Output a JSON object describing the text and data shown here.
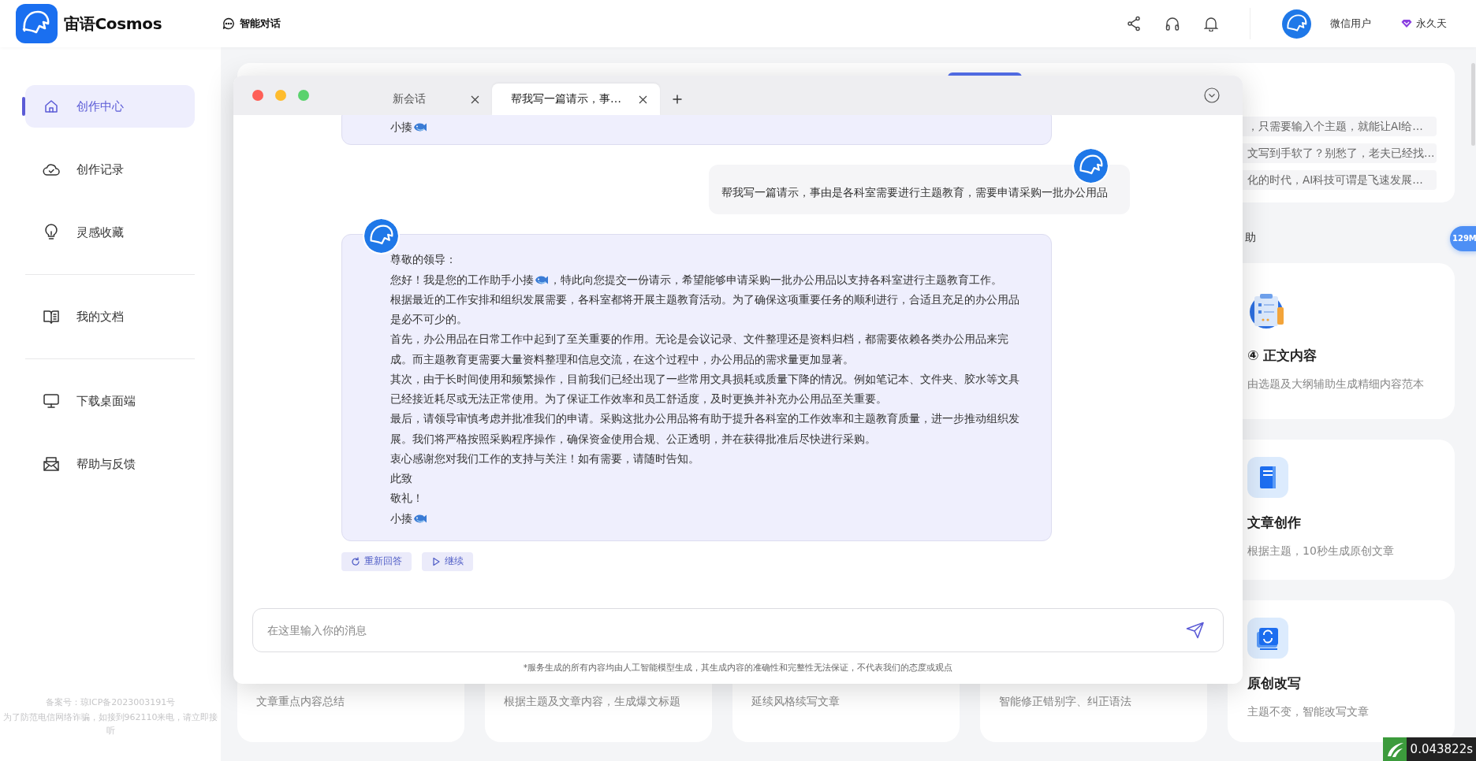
{
  "header": {
    "brand": "宙语Cosmos",
    "nav_label": "智能对话",
    "user_name": "微信用户",
    "membership": "永久天"
  },
  "sidebar": {
    "sections": [
      {
        "items": [
          {
            "label": "创作中心",
            "selected": true
          },
          {
            "label": "创作记录",
            "selected": false
          },
          {
            "label": "灵感收藏",
            "selected": false
          }
        ]
      },
      {
        "items": [
          {
            "label": "我的文档",
            "selected": false
          }
        ]
      },
      {
        "items": [
          {
            "label": "下载桌面端",
            "selected": false
          },
          {
            "label": "帮助与反馈",
            "selected": false
          }
        ]
      }
    ],
    "footer": [
      "备案号：琼ICP备2023003191号",
      "为了防范电信网络诈骗，如接到962110来电，请立即接听"
    ]
  },
  "background": {
    "suggestions": [
      "，只需要输入个主题，就能让AI给…",
      "文写到手软了？别愁了，老夫已经找…",
      "化的时代，AI科技可谓是飞速发展…"
    ],
    "section_heading": "助",
    "memory_badge": "129M",
    "feature_cards": [
      {
        "title": "④ 正文内容",
        "description": "由选题及大纲辅助生成精细内容范本"
      },
      {
        "title": "文章创作",
        "description": "根据主题，10秒生成原创文章"
      },
      {
        "title": "原创改写",
        "description": "主题不变，智能改写文章"
      }
    ],
    "bottom_cards": [
      {
        "description": "文章重点内容总结"
      },
      {
        "description": "根据主题及文章内容，生成爆文标题"
      },
      {
        "description": "延续风格续写文章"
      },
      {
        "description": "智能修正错别字、纠正语法"
      }
    ]
  },
  "chat_window": {
    "tabs": [
      {
        "label": "新会话",
        "selected": false
      },
      {
        "label": "帮我写一篇请示，事…",
        "selected": true
      }
    ],
    "messages": [
      {
        "kind": "assistant",
        "clipped": true,
        "paragraphs": [
          {
            "parts": [
              "小揍"
            ],
            "fish": true
          }
        ]
      },
      {
        "kind": "user",
        "clipped": false,
        "paragraphs": [
          {
            "parts": [
              "帮我写一篇请示，事由是各科室需要进行主题教育，需要申请采购一批办公用品"
            ],
            "fish": false
          }
        ]
      },
      {
        "kind": "assistant",
        "clipped": false,
        "paragraphs": [
          {
            "parts": [
              "尊敬的领导："
            ],
            "fish": false
          },
          {
            "parts": [
              "您好！我是您的工作助手小揍",
              "，特此向您提交一份请示，希望能够申请采购一批办公用品以支持各科室进行主题教育工作。"
            ],
            "fish": false
          },
          {
            "parts": [
              "根据最近的工作安排和组织发展需要，各科室都将开展主题教育活动。为了确保这项重要任务的顺利进行，合适且充足的办公用品是必不可少的。"
            ],
            "fish": false
          },
          {
            "parts": [
              "首先，办公用品在日常工作中起到了至关重要的作用。无论是会议记录、文件整理还是资料归档，都需要依赖各类办公用品来完成。而主题教育更需要大量资料整理和信息交流，在这个过程中，办公用品的需求量更加显著。"
            ],
            "fish": false
          },
          {
            "parts": [
              "其次，由于长时间使用和频繁操作，目前我们已经出现了一些常用文具损耗或质量下降的情况。例如笔记本、文件夹、胶水等文具已经接近耗尽或无法正常使用。为了保证工作效率和员工舒适度，及时更换并补充办公用品至关重要。"
            ],
            "fish": false
          },
          {
            "parts": [
              "最后，请领导审慎考虑并批准我们的申请。采购这批办公用品将有助于提升各科室的工作效率和主题教育质量，进一步推动组织发展。我们将严格按照采购程序操作，确保资金使用合规、公正透明，并在获得批准后尽快进行采购。"
            ],
            "fish": false
          },
          {
            "parts": [
              "衷心感谢您对我们工作的支持与关注！如有需要，请随时告知。"
            ],
            "fish": false
          },
          {
            "parts": [
              "此致"
            ],
            "fish": false
          },
          {
            "parts": [
              "敬礼！"
            ],
            "fish": false
          },
          {
            "parts": [
              "小揍"
            ],
            "fish": true
          }
        ]
      }
    ],
    "actions": [
      {
        "label": "重新回答"
      },
      {
        "label": "继续"
      }
    ],
    "input": {
      "placeholder": "在这里输入你的消息"
    },
    "disclaimer": "*服务生成的所有内容均由人工智能模型生成，其生成内容的准确性和完整性无法保证，不代表我们的态度或观点"
  },
  "timing_badge": "0.043822s"
}
